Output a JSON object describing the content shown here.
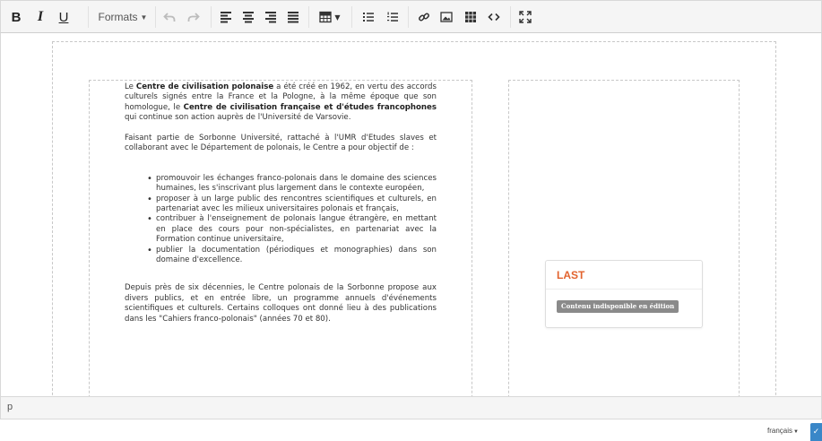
{
  "toolbar": {
    "bold": "B",
    "italic": "I",
    "underline": "U",
    "formats_label": "Formats",
    "icons": [
      "bold-icon",
      "italic-icon",
      "underline-icon",
      "undo-icon",
      "redo-icon",
      "align-left-icon",
      "align-center-icon",
      "align-right-icon",
      "align-justify-icon",
      "table-icon",
      "bullet-list-icon",
      "numbered-list-icon",
      "link-icon",
      "image-icon",
      "widget-grid-icon",
      "source-code-icon",
      "fullscreen-icon"
    ]
  },
  "content": {
    "p1": {
      "t1": "Le ",
      "b1": "Centre de civilisation polonaise",
      "t2": " a été créé en 1962, en vertu des accords culturels signés entre la France et la Pologne, à la même époque que son homologue, le ",
      "b2": "Centre de civilisation française et d'études francophones",
      "t3": " qui continue son action auprès de l'Université de Varsovie."
    },
    "p2": "Faisant partie de Sorbonne Université, rattaché à l'UMR d'Etudes slaves et collaborant avec le Département de polonais, le Centre a pour objectif de :",
    "bullets": [
      "promouvoir les échanges franco-polonais dans le domaine des sciences humaines, les s'inscrivant plus largement dans le contexte européen,",
      "proposer à un large public des rencontres scientifiques et culturels, en partenariat avec les milieux universitaires polonais et français,",
      "contribuer à l'enseignement de polonais langue étrangère, en mettant en place des cours pour non-spécialistes, en partenariat avec la Formation continue universitaire,",
      "publier la documentation (périodiques et monographies) dans son domaine d'excellence."
    ],
    "p3": "Depuis près de six décennies, le Centre polonais de la Sorbonne propose aux divers publics, et en entrée libre, un programme annuels d'événements scientifiques et culturels. Certains colloques ont donné lieu à des publications dans les \"Cahiers franco-polonais\" (années 70 et 80)."
  },
  "widget": {
    "title": "LAST",
    "badge": "Contenu indisponible en édition",
    "title_color": "#e2632e"
  },
  "statusbar": {
    "path": "p"
  },
  "language": {
    "label": "français",
    "accent": "#3a87c8"
  }
}
